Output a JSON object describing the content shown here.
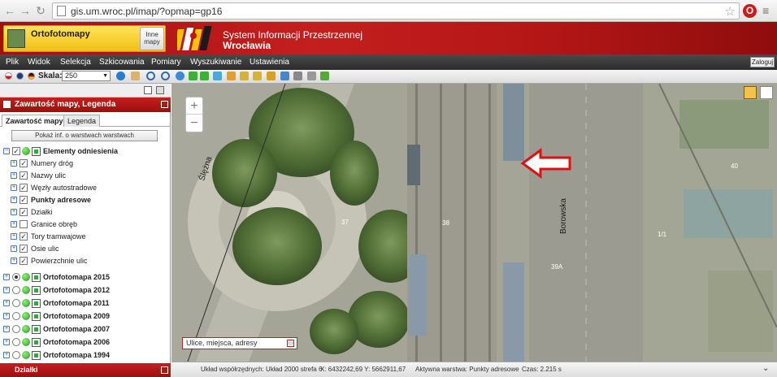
{
  "browser": {
    "url": "gis.um.wroc.pl/imap/?opmap=gp16"
  },
  "header": {
    "layer_title": "Ortofotomapy",
    "other_maps_label": "Inne mapy",
    "system_name": "System Informacji Przestrzennej",
    "city": "Wrocławia"
  },
  "menu": {
    "items": [
      "Plik",
      "Widok",
      "Selekcja",
      "Szkicowania",
      "Pomiary",
      "Wyszukiwanie",
      "Ustawienia"
    ],
    "login": "Zaloguj"
  },
  "toolbar": {
    "scale_label": "Skala:",
    "scale_value": "250"
  },
  "panel": {
    "title": "Zawartość mapy, Legenda",
    "tabs": [
      "Zawartość mapy",
      "Legenda"
    ],
    "info_button": "Pokaż inf. o warstwach warstwach",
    "layers": [
      {
        "label": "Elementy odniesienia",
        "bold": true
      },
      {
        "label": "Numery dróg",
        "bold": false
      },
      {
        "label": "Nazwy ulic",
        "bold": false
      },
      {
        "label": "Węzły autostradowe",
        "bold": false
      },
      {
        "label": "Punkty adresowe",
        "bold": true
      },
      {
        "label": "Działki",
        "bold": false
      },
      {
        "label": "Granice obręb",
        "bold": false
      },
      {
        "label": "Tory tramwajowe",
        "bold": false
      },
      {
        "label": "Osie ulic",
        "bold": false
      },
      {
        "label": "Powierzchnie ulic",
        "bold": false
      },
      {
        "label": "Ortofotomapa 2015",
        "bold": true
      },
      {
        "label": "Ortofotomapa 2012",
        "bold": true
      },
      {
        "label": "Ortofotomapa 2011",
        "bold": true
      },
      {
        "label": "Ortofotomapa 2009",
        "bold": true
      },
      {
        "label": "Ortofotomapa 2007",
        "bold": true
      },
      {
        "label": "Ortofotomapa 2006",
        "bold": true
      },
      {
        "label": "Ortofotomapa 1994",
        "bold": true
      }
    ],
    "bottom_title": "Działki"
  },
  "map": {
    "street_labels": [
      "Ślężna",
      "Borowska"
    ],
    "numbers": [
      "37",
      "38",
      "39A",
      "1/1",
      "40"
    ],
    "search_box": "Ulice, miejsca, adresy"
  },
  "status": {
    "coords_system": "Układ współrzędnych: Układ 2000 strefa 6",
    "coords": "X: 6432242,69 Y: 5662911,67",
    "active_layer": "Aktywna warstwa: Punkty adresowe",
    "time": "Czas: 2.215 s"
  },
  "colors": {
    "header_red": "#b41616",
    "layer_yellow": "#f1bf14",
    "arrow_red": "#e01010"
  }
}
